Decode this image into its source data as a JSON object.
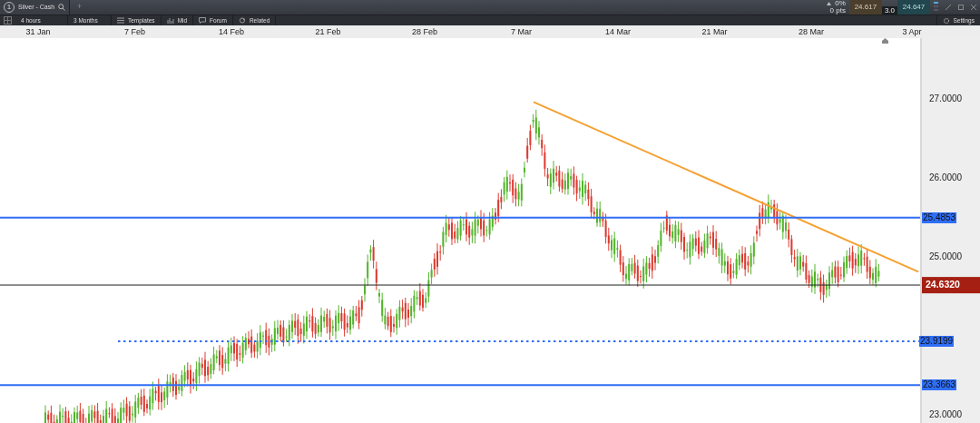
{
  "window": {
    "tab_number": "1",
    "title": "Silver - Cash",
    "add_tab": "+"
  },
  "quote": {
    "change": "0%",
    "points": "0 pts",
    "sell": "24.617",
    "buy": "24.647",
    "spread": "3.0"
  },
  "toolbar": {
    "items": [
      {
        "kind": "interval",
        "label": "4 hours"
      },
      {
        "kind": "range",
        "label": "3 Months"
      },
      {
        "kind": "templates",
        "label": "Templates"
      },
      {
        "kind": "mid",
        "label": "Mid"
      },
      {
        "kind": "forum",
        "label": "Forum"
      },
      {
        "kind": "related",
        "label": "Related"
      }
    ],
    "settings": "Settings"
  },
  "date_axis": [
    "31 Jan",
    "7 Feb",
    "14 Feb",
    "21 Feb",
    "28 Feb",
    "7 Mar",
    "14 Mar",
    "21 Mar",
    "28 Mar",
    "3 Apr"
  ],
  "price_axis": [
    "27.0000",
    "26.0000",
    "25.0000",
    "23.0000"
  ],
  "current_price": "24.6320",
  "levels": [
    {
      "value": "25.4853",
      "kind": "solid"
    },
    {
      "value": "23.9199",
      "kind": "dotted"
    },
    {
      "value": "23.3663",
      "kind": "solid"
    }
  ]
}
